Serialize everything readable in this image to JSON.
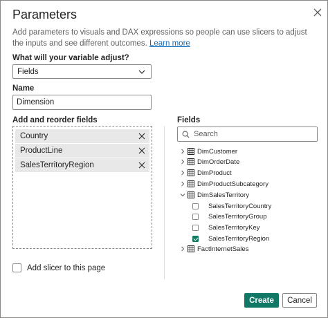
{
  "dialog": {
    "title": "Parameters",
    "description": "Add parameters to visuals and DAX expressions so people can use slicers to adjust the inputs and see different outcomes.",
    "learn_more": "Learn more",
    "close_icon": "close-icon"
  },
  "variable": {
    "label": "What will your variable adjust?",
    "selected": "Fields"
  },
  "name": {
    "label": "Name",
    "value": "Dimension"
  },
  "reorder": {
    "label": "Add and reorder fields",
    "items": [
      {
        "label": "Country"
      },
      {
        "label": "ProductLine"
      },
      {
        "label": "SalesTerritoryRegion"
      }
    ]
  },
  "slicer": {
    "label": "Add slicer to this page",
    "checked": false
  },
  "fields": {
    "label": "Fields",
    "search_placeholder": "Search",
    "tables": [
      {
        "name": "DimCustomer",
        "expanded": false
      },
      {
        "name": "DimOrderDate",
        "expanded": false
      },
      {
        "name": "DimProduct",
        "expanded": false
      },
      {
        "name": "DimProductSubcategory",
        "expanded": false
      },
      {
        "name": "DimSalesTerritory",
        "expanded": true
      },
      {
        "name": "FactInternetSales",
        "expanded": false
      }
    ],
    "territory_fields": [
      {
        "name": "SalesTerritoryCountry",
        "checked": false
      },
      {
        "name": "SalesTerritoryGroup",
        "checked": false
      },
      {
        "name": "SalesTerritoryKey",
        "checked": false
      },
      {
        "name": "SalesTerritoryRegion",
        "checked": true
      }
    ]
  },
  "buttons": {
    "create": "Create",
    "cancel": "Cancel"
  },
  "colors": {
    "accent": "#117865",
    "link": "#0f6cbd",
    "border": "#8a8886",
    "chip_bg": "#e8e8e8"
  }
}
